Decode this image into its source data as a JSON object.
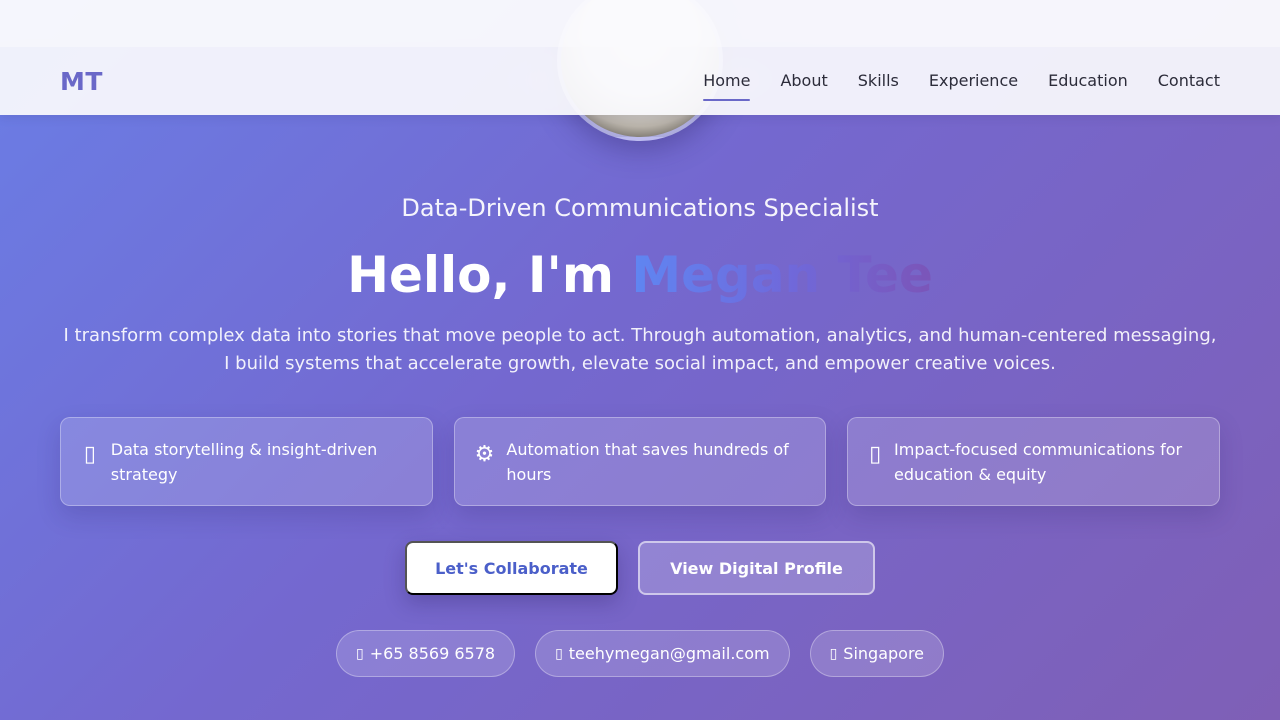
{
  "nav": {
    "logo": "MT",
    "links": [
      {
        "label": "Home",
        "active": true
      },
      {
        "label": "About"
      },
      {
        "label": "Skills"
      },
      {
        "label": "Experience"
      },
      {
        "label": "Education"
      },
      {
        "label": "Contact"
      }
    ]
  },
  "hero": {
    "subtitle": "Data-Driven Communications Specialist",
    "greeting": "Hello, I'm ",
    "name": "Megan Tee",
    "intro": "I transform complex data into stories that move people to act. Through automation, analytics, and human-centered messaging, I build systems that accelerate growth, elevate social impact, and empower creative voices."
  },
  "features": [
    {
      "icon": "chart-icon",
      "glyph": "▯",
      "text": "Data storytelling & insight-driven strategy"
    },
    {
      "icon": "gear-icon",
      "glyph": "⚙",
      "text": "Automation that saves hundreds of hours"
    },
    {
      "icon": "impact-icon",
      "glyph": "▯",
      "text": "Impact-focused communications for education & equity"
    }
  ],
  "buttons": {
    "primary": "Let's Collaborate",
    "secondary": "View Digital Profile"
  },
  "contacts": {
    "phone": {
      "icon": "phone-icon",
      "glyph": "▯",
      "text": "+65 8569 6578"
    },
    "email": {
      "icon": "email-icon",
      "glyph": "▯",
      "text": "teehymegan@gmail.com"
    },
    "location": {
      "icon": "location-icon",
      "glyph": "▯",
      "text": "Singapore"
    }
  },
  "colors": {
    "accent": "#6a68c8",
    "primary_button_text": "#4b5fc9",
    "gradient_start": "#6a7ee6",
    "gradient_end": "#7f5fb6"
  }
}
